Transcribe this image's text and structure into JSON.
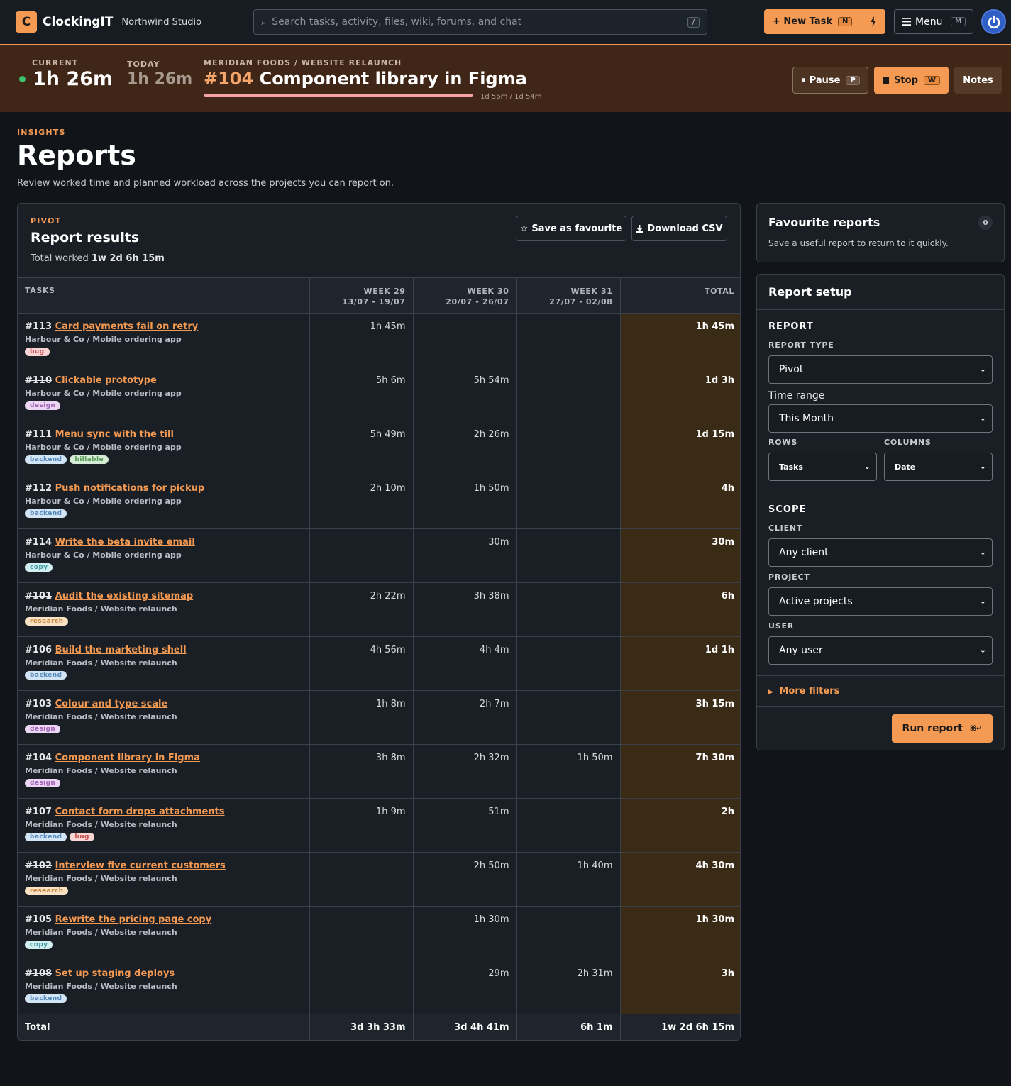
{
  "topbar": {
    "logo_letter": "C",
    "app_name": "ClockingIT",
    "org_name": "Northwind Studio",
    "search_placeholder": "Search tasks, activity, files, wiki, forums, and chat",
    "search_key": "/",
    "new_task_label": "+ New Task",
    "new_task_key": "N",
    "menu_label": "Menu",
    "menu_key": "M"
  },
  "timer": {
    "current_label": "CURRENT",
    "current_value": "1h 26m",
    "today_label": "TODAY",
    "today_value": "1h 26m",
    "project_path": "MERIDIAN FOODS / WEBSITE RELAUNCH",
    "task_number": "#104",
    "task_title": "Component library in Figma",
    "progress_text": "1d 56m / 1d 54m",
    "progress_fraction": 1.0,
    "pause_label": "Pause",
    "pause_key": "P",
    "stop_label": "Stop",
    "stop_key": "W",
    "notes_label": "Notes"
  },
  "page": {
    "eyebrow": "INSIGHTS",
    "title": "Reports",
    "subtitle": "Review worked time and planned workload across the projects you can report on."
  },
  "report": {
    "eyebrow": "PIVOT",
    "title": "Report results",
    "total_label": "Total worked",
    "total_value": "1w 2d 6h 15m",
    "fav_button": "Save as favourite",
    "csv_button": "Download CSV",
    "columns": {
      "tasks": "TASKS",
      "w29": "WEEK 29",
      "w29_range": "13/07 - 19/07",
      "w30": "WEEK 30",
      "w30_range": "20/07 - 26/07",
      "w31": "WEEK 31",
      "w31_range": "27/07 - 02/08",
      "total": "TOTAL"
    },
    "rows": [
      {
        "num": "#113",
        "done": false,
        "name": "Card payments fail on retry",
        "project": "Harbour & Co / Mobile ordering app",
        "tags": [
          "bug"
        ],
        "w29": "1h 45m",
        "w30": "",
        "w31": "",
        "total": "1h 45m"
      },
      {
        "num": "#110",
        "done": true,
        "name": "Clickable prototype",
        "project": "Harbour & Co / Mobile ordering app",
        "tags": [
          "design"
        ],
        "w29": "5h 6m",
        "w30": "5h 54m",
        "w31": "",
        "total": "1d 3h"
      },
      {
        "num": "#111",
        "done": false,
        "name": "Menu sync with the till",
        "project": "Harbour & Co / Mobile ordering app",
        "tags": [
          "backend",
          "billable"
        ],
        "w29": "5h 49m",
        "w30": "2h 26m",
        "w31": "",
        "total": "1d 15m"
      },
      {
        "num": "#112",
        "done": false,
        "name": "Push notifications for pickup",
        "project": "Harbour & Co / Mobile ordering app",
        "tags": [
          "backend"
        ],
        "w29": "2h 10m",
        "w30": "1h 50m",
        "w31": "",
        "total": "4h"
      },
      {
        "num": "#114",
        "done": false,
        "name": "Write the beta invite email",
        "project": "Harbour & Co / Mobile ordering app",
        "tags": [
          "copy"
        ],
        "w29": "",
        "w30": "30m",
        "w31": "",
        "total": "30m"
      },
      {
        "num": "#101",
        "done": true,
        "name": "Audit the existing sitemap",
        "project": "Meridian Foods / Website relaunch",
        "tags": [
          "research"
        ],
        "w29": "2h 22m",
        "w30": "3h 38m",
        "w31": "",
        "total": "6h"
      },
      {
        "num": "#106",
        "done": false,
        "name": "Build the marketing shell",
        "project": "Meridian Foods / Website relaunch",
        "tags": [
          "backend"
        ],
        "w29": "4h 56m",
        "w30": "4h 4m",
        "w31": "",
        "total": "1d 1h"
      },
      {
        "num": "#103",
        "done": true,
        "name": "Colour and type scale",
        "project": "Meridian Foods / Website relaunch",
        "tags": [
          "design"
        ],
        "w29": "1h 8m",
        "w30": "2h 7m",
        "w31": "",
        "total": "3h 15m"
      },
      {
        "num": "#104",
        "done": false,
        "name": "Component library in Figma",
        "project": "Meridian Foods / Website relaunch",
        "tags": [
          "design"
        ],
        "w29": "3h 8m",
        "w30": "2h 32m",
        "w31": "1h 50m",
        "total": "7h 30m"
      },
      {
        "num": "#107",
        "done": false,
        "name": "Contact form drops attachments",
        "project": "Meridian Foods / Website relaunch",
        "tags": [
          "backend",
          "bug"
        ],
        "w29": "1h 9m",
        "w30": "51m",
        "w31": "",
        "total": "2h"
      },
      {
        "num": "#102",
        "done": true,
        "name": "Interview five current customers",
        "project": "Meridian Foods / Website relaunch",
        "tags": [
          "research"
        ],
        "w29": "",
        "w30": "2h 50m",
        "w31": "1h 40m",
        "total": "4h 30m"
      },
      {
        "num": "#105",
        "done": false,
        "name": "Rewrite the pricing page copy",
        "project": "Meridian Foods / Website relaunch",
        "tags": [
          "copy"
        ],
        "w29": "",
        "w30": "1h 30m",
        "w31": "",
        "total": "1h 30m"
      },
      {
        "num": "#108",
        "done": true,
        "name": "Set up staging deploys",
        "project": "Meridian Foods / Website relaunch",
        "tags": [
          "backend"
        ],
        "w29": "",
        "w30": "29m",
        "w31": "2h 31m",
        "total": "3h"
      }
    ],
    "footer": {
      "label": "Total",
      "w29": "3d 3h 33m",
      "w30": "3d 4h 41m",
      "w31": "6h 1m",
      "total": "1w 2d 6h 15m"
    }
  },
  "favourites": {
    "title": "Favourite reports",
    "count": "0",
    "subtitle": "Save a useful report to return to it quickly."
  },
  "setup": {
    "title": "Report setup",
    "report_heading": "REPORT",
    "report_type_label": "REPORT TYPE",
    "report_type_value": "Pivot",
    "time_range_label": "Time range",
    "time_range_value": "This Month",
    "rows_label": "ROWS",
    "rows_value": "Tasks",
    "columns_label": "COLUMNS",
    "columns_value": "Date",
    "scope_heading": "SCOPE",
    "client_label": "CLIENT",
    "client_value": "Any client",
    "project_label": "PROJECT",
    "project_value": "Active projects",
    "user_label": "USER",
    "user_value": "Any user",
    "more_filters": "More filters",
    "run_label": "Run report",
    "run_key": "⌘↵"
  },
  "colors": {
    "accent": "#f59a52",
    "timer_bg": "#3f2616",
    "total_col_bg": "#3a2b16",
    "live_dot": "#3fc06d"
  }
}
